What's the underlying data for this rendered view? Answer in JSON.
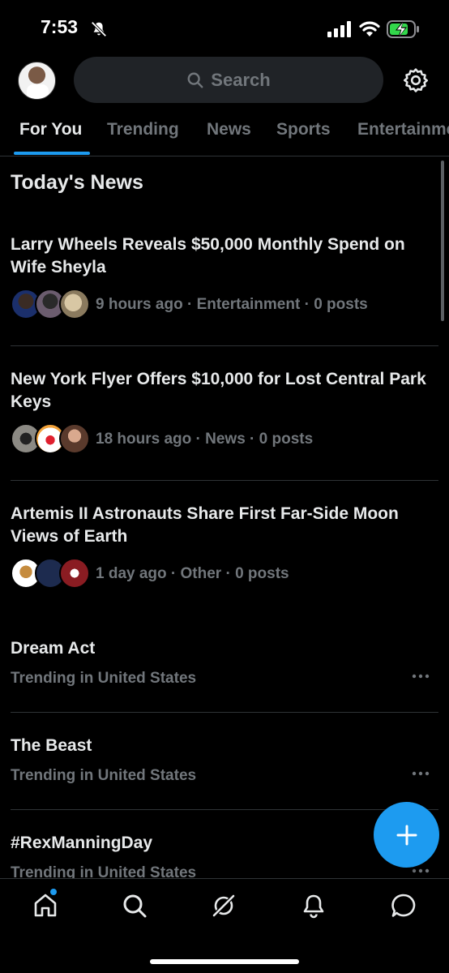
{
  "status_bar": {
    "time": "7:53"
  },
  "header": {
    "search_placeholder": "Search"
  },
  "tabs": [
    {
      "label": "For You"
    },
    {
      "label": "Trending"
    },
    {
      "label": "News"
    },
    {
      "label": "Sports"
    },
    {
      "label": "Entertainment"
    }
  ],
  "section_title": "Today's News",
  "news": [
    {
      "headline": "Larry Wheels Reveals $50,000 Monthly Spend on Wife Sheyla",
      "meta": "9 hours ago · Entertainment · 0 posts"
    },
    {
      "headline": "New York Flyer Offers $10,000 for Lost Central Park Keys",
      "meta": "18 hours ago · News · 0 posts"
    },
    {
      "headline": "Artemis II Astronauts Share First Far-Side Moon Views of Earth",
      "meta": "1 day ago · Other · 0 posts"
    }
  ],
  "trends": [
    {
      "name": "Dream Act",
      "context": "Trending in United States"
    },
    {
      "name": "The Beast",
      "context": "Trending in United States"
    },
    {
      "name": "#RexManningDay",
      "context": "Trending in United States"
    }
  ],
  "colors": {
    "accent": "#1d9bf0",
    "background": "#000000",
    "muted_text": "#71767b"
  },
  "icons": {
    "fab": "plus-icon",
    "bottom_nav": [
      "home-icon",
      "search-icon",
      "grok-icon",
      "bell-icon",
      "message-icon"
    ]
  }
}
